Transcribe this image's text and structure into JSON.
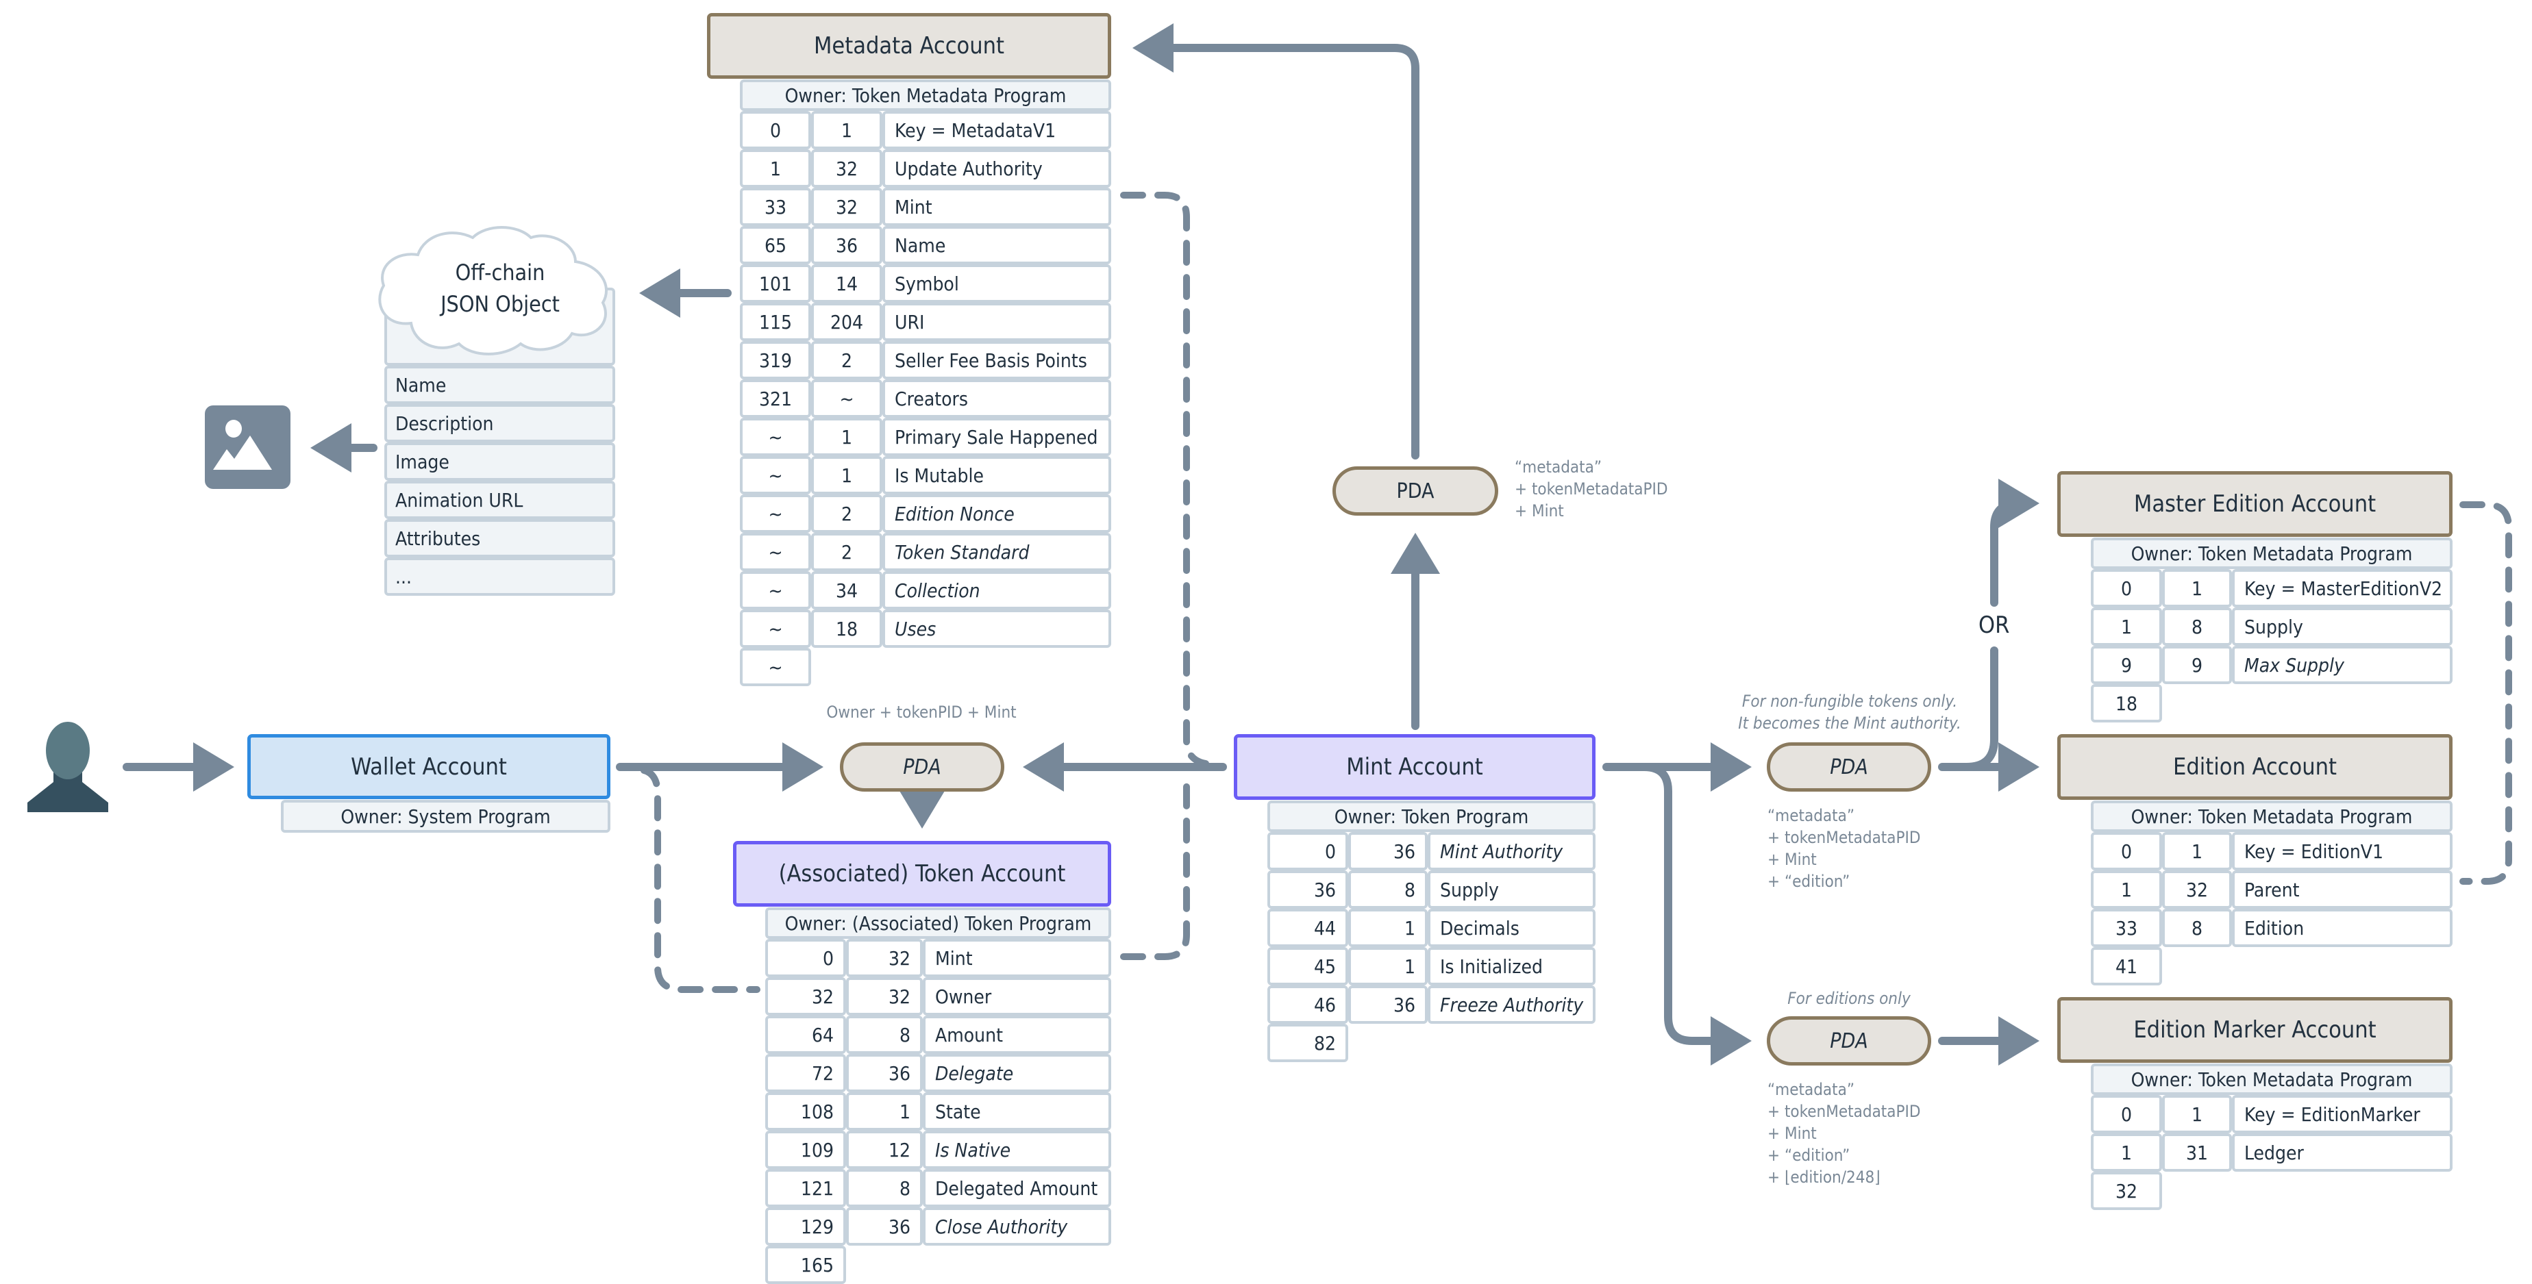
{
  "colors": {
    "connector": "#778899",
    "program_account_fill": "#e6e3de",
    "program_account_border": "#8a7a5e",
    "token_account_fill": "#dfdcfb",
    "token_account_border": "#6a5cf5",
    "wallet_fill": "#d3e5f6",
    "wallet_border": "#2f8be0",
    "owner_fill": "#f0f4f7",
    "cell_border": "#c6d2dc"
  },
  "user": {
    "icon": "person-icon"
  },
  "wallet": {
    "title": "Wallet Account",
    "owner": "Owner: System Program"
  },
  "token_pda": {
    "label": "PDA",
    "seeds": "Owner + tokenPID + Mint"
  },
  "token_account": {
    "title": "(Associated) Token Account",
    "owner": "Owner: (Associated) Token Program",
    "rows": [
      {
        "offset": "0",
        "size": "32",
        "field": "Mint",
        "optional": false
      },
      {
        "offset": "32",
        "size": "32",
        "field": "Owner",
        "optional": false
      },
      {
        "offset": "64",
        "size": "8",
        "field": "Amount",
        "optional": false
      },
      {
        "offset": "72",
        "size": "36",
        "field": "Delegate",
        "optional": true
      },
      {
        "offset": "108",
        "size": "1",
        "field": "State",
        "optional": false
      },
      {
        "offset": "109",
        "size": "12",
        "field": "Is Native",
        "optional": true
      },
      {
        "offset": "121",
        "size": "8",
        "field": "Delegated Amount",
        "optional": false
      },
      {
        "offset": "129",
        "size": "36",
        "field": "Close Authority",
        "optional": true
      }
    ],
    "total": "165"
  },
  "mint_account": {
    "title": "Mint Account",
    "owner": "Owner: Token Program",
    "rows": [
      {
        "offset": "0",
        "size": "36",
        "field": "Mint Authority",
        "optional": true
      },
      {
        "offset": "36",
        "size": "8",
        "field": "Supply",
        "optional": false
      },
      {
        "offset": "44",
        "size": "1",
        "field": "Decimals",
        "optional": false
      },
      {
        "offset": "45",
        "size": "1",
        "field": "Is Initialized",
        "optional": false
      },
      {
        "offset": "46",
        "size": "36",
        "field": "Freeze Authority",
        "optional": true
      }
    ],
    "total": "82"
  },
  "metadata_pda": {
    "label": "PDA",
    "seeds": "“metadata”\n+ tokenMetadataPID\n+ Mint"
  },
  "metadata_account": {
    "title": "Metadata Account",
    "owner": "Owner: Token Metadata Program",
    "rows": [
      {
        "offset": "0",
        "size": "1",
        "field": "Key = MetadataV1",
        "optional": false
      },
      {
        "offset": "1",
        "size": "32",
        "field": "Update Authority",
        "optional": false
      },
      {
        "offset": "33",
        "size": "32",
        "field": "Mint",
        "optional": false
      },
      {
        "offset": "65",
        "size": "36",
        "field": "Name",
        "optional": false
      },
      {
        "offset": "101",
        "size": "14",
        "field": "Symbol",
        "optional": false
      },
      {
        "offset": "115",
        "size": "204",
        "field": "URI",
        "optional": false
      },
      {
        "offset": "319",
        "size": "2",
        "field": "Seller Fee Basis Points",
        "optional": false
      },
      {
        "offset": "321",
        "size": "~",
        "field": "Creators",
        "optional": false
      },
      {
        "offset": "~",
        "size": "1",
        "field": "Primary Sale Happened",
        "optional": false
      },
      {
        "offset": "~",
        "size": "1",
        "field": "Is Mutable",
        "optional": false
      },
      {
        "offset": "~",
        "size": "2",
        "field": "Edition Nonce",
        "optional": true
      },
      {
        "offset": "~",
        "size": "2",
        "field": "Token Standard",
        "optional": true
      },
      {
        "offset": "~",
        "size": "34",
        "field": "Collection",
        "optional": true
      },
      {
        "offset": "~",
        "size": "18",
        "field": "Uses",
        "optional": true
      }
    ],
    "total": "~"
  },
  "offchain_json": {
    "title_line1": "Off-chain",
    "title_line2": "JSON Object",
    "fields": [
      "Name",
      "Description",
      "Image",
      "Animation URL",
      "Attributes",
      "..."
    ]
  },
  "image_asset": {
    "icon": "image-icon"
  },
  "edition_pda": {
    "label": "PDA",
    "note": "For non-fungible tokens only.\nIt becomes the Mint authority.",
    "seeds": "“metadata”\n+ tokenMetadataPID\n+ Mint\n+ “edition”"
  },
  "or_label": "OR",
  "master_edition_account": {
    "title": "Master Edition Account",
    "owner": "Owner: Token Metadata Program",
    "rows": [
      {
        "offset": "0",
        "size": "1",
        "field": "Key = MasterEditionV2",
        "optional": false
      },
      {
        "offset": "1",
        "size": "8",
        "field": "Supply",
        "optional": false
      },
      {
        "offset": "9",
        "size": "9",
        "field": "Max Supply",
        "optional": true
      }
    ],
    "total": "18"
  },
  "edition_account": {
    "title": "Edition Account",
    "owner": "Owner: Token Metadata Program",
    "rows": [
      {
        "offset": "0",
        "size": "1",
        "field": "Key = EditionV1",
        "optional": false
      },
      {
        "offset": "1",
        "size": "32",
        "field": "Parent",
        "optional": false
      },
      {
        "offset": "33",
        "size": "8",
        "field": "Edition",
        "optional": false
      }
    ],
    "total": "41"
  },
  "edition_marker_pda": {
    "label": "PDA",
    "note": "For editions only",
    "seeds": "“metadata”\n+ tokenMetadataPID\n+ Mint\n+ “edition”\n+ ⌊edition/248⌋"
  },
  "edition_marker_account": {
    "title": "Edition Marker Account",
    "owner": "Owner: Token Metadata Program",
    "rows": [
      {
        "offset": "0",
        "size": "1",
        "field": "Key = EditionMarker",
        "optional": false
      },
      {
        "offset": "1",
        "size": "31",
        "field": "Ledger",
        "optional": false
      }
    ],
    "total": "32"
  }
}
